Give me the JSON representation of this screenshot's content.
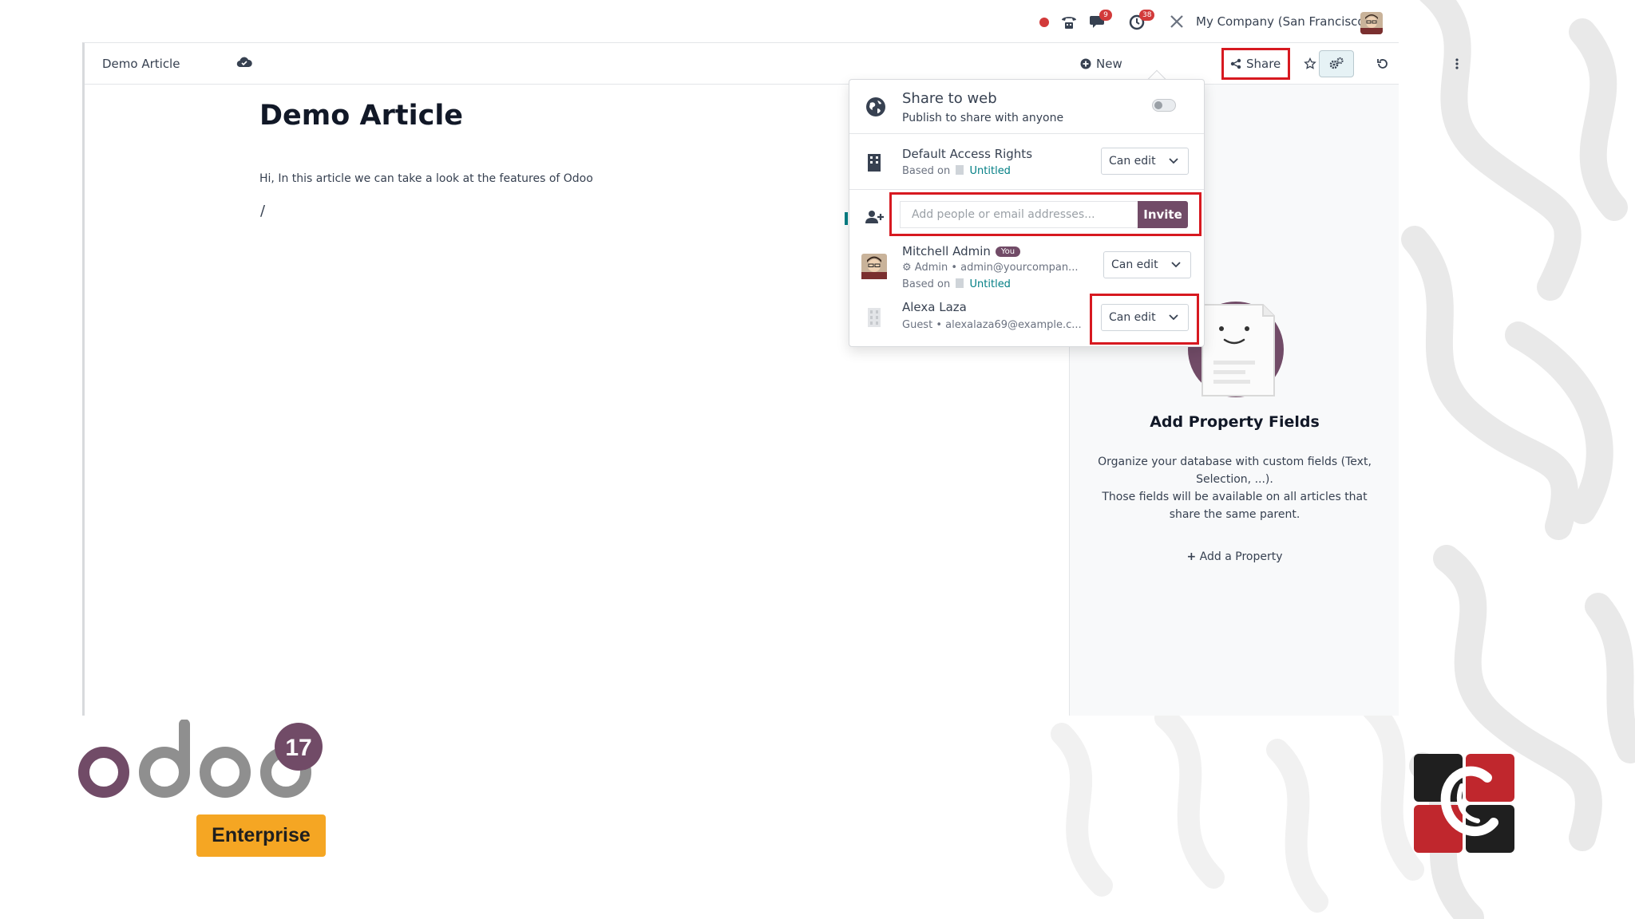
{
  "topbar": {
    "notifications": {
      "messages_count": "9",
      "activities_count": "38"
    },
    "company": "My Company (San Francisco)"
  },
  "control_bar": {
    "breadcrumb": "Demo Article",
    "new_label": "New",
    "share_label": "Share"
  },
  "article": {
    "title": "Demo Article",
    "body": "Hi, In this article we can take a look at the features of Odoo",
    "cursor_line": "/"
  },
  "share_panel": {
    "web": {
      "title": "Share to web",
      "subtitle": "Publish to share with anyone",
      "published": false
    },
    "default_rights": {
      "title": "Default Access Rights",
      "based_on_prefix": "Based on",
      "based_on_article": "Untitled",
      "permission": "Can edit"
    },
    "invite": {
      "placeholder": "Add people or email addresses...",
      "button": "Invite"
    },
    "members": [
      {
        "name": "Mitchell Admin",
        "badge": "You",
        "role_line": "Admin • admin@yourcompan...",
        "based_on_prefix": "Based on",
        "based_on_article": "Untitled",
        "permission": "Can edit"
      },
      {
        "name": "Alexa Laza",
        "role_line": "Guest • alexalaza69@example.c...",
        "permission": "Can edit"
      }
    ]
  },
  "properties": {
    "title": "Add Property Fields",
    "description_1": "Organize your database with custom fields (Text, Selection, ...).",
    "description_2": "Those fields will be available on all articles that share the same parent.",
    "add_label": "Add a Property"
  },
  "branding": {
    "logo_text": "odoo",
    "version": "17",
    "edition": "Enterprise"
  },
  "colors": {
    "accent": "#714b67",
    "link": "#017e84",
    "highlight": "#d71920",
    "edition_badge": "#f5a623"
  }
}
